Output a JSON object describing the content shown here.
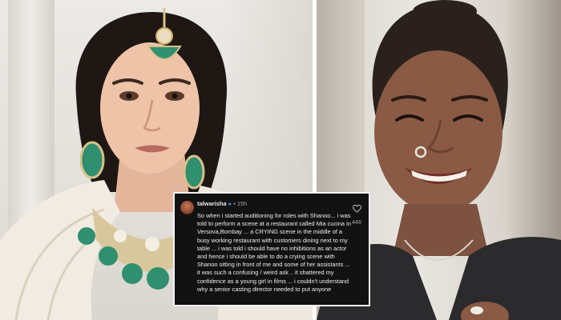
{
  "photos": {
    "left": {
      "subject": "woman in bridal jewellery",
      "jewellery_color": "#2f8f6e"
    },
    "right": {
      "subject": "smiling woman with nose ring"
    }
  },
  "comment": {
    "username": "talwarisha",
    "verified_icon": "verified-badge-icon",
    "separator": "•",
    "time": "15h",
    "text": "So when i started auditioning for roles with Shanoo... i was told to perform a scene at a restaurant called Mia cucina in Versova,Bombay ... a CRYING scene in the middle of a busy working restaurant with customers dining next to my table ... i was told i should have no inhibitions as an actor and hence i should be able to do a crying scene with Shanoo sitting in front of me and some of her assistants ... it was such a confusing / weird ask .. it shattered my confidence as a young girl in films ... i couldn't understand why a senior casting director needed to put anyone",
    "like_icon": "heart-outline-icon",
    "likes": "446",
    "colors": {
      "background": "#121212",
      "text": "#efefef",
      "meta": "#a8a8a8",
      "border": "#f2f2f2"
    }
  }
}
